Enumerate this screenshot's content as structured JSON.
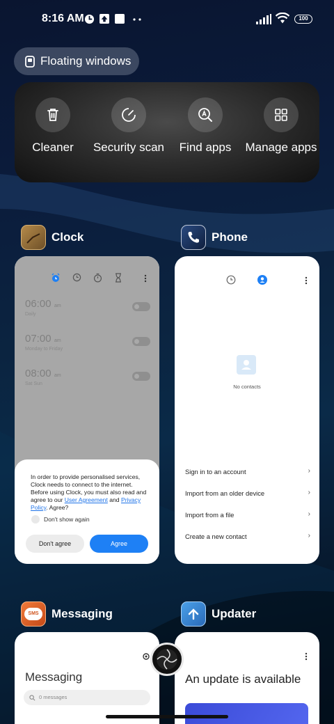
{
  "status_bar": {
    "time": "8:16 AM",
    "battery": "100"
  },
  "floating_windows": {
    "label": "Floating windows"
  },
  "tools": [
    {
      "label": "Cleaner",
      "icon": "trash-icon"
    },
    {
      "label": "Security scan",
      "icon": "security-scan-icon"
    },
    {
      "label": "Find apps",
      "icon": "find-apps-icon"
    },
    {
      "label": "Manage apps",
      "icon": "grid-icon"
    }
  ],
  "apps": {
    "clock": {
      "name": "Clock",
      "alarms": [
        {
          "time": "06:00",
          "ampm": "am",
          "repeat": "Daily"
        },
        {
          "time": "07:00",
          "ampm": "am",
          "repeat": "Monday to Friday"
        },
        {
          "time": "08:00",
          "ampm": "am",
          "repeat": "Sat Sun"
        }
      ],
      "dialog": {
        "text_before": "In order to provide personalised services, Clock needs to connect to the internet. Before using Clock, you must also read and agree to our ",
        "user_agreement": "User Agreement",
        "and": " and ",
        "privacy_policy": "Privacy Policy",
        "text_after": ". Agree?",
        "dont_show": "Don't show again",
        "disagree": "Don't agree",
        "agree": "Agree"
      }
    },
    "phone": {
      "name": "Phone",
      "no_contacts": "No contacts",
      "menu": [
        "Sign in to an account",
        "Import from an older device",
        "Import from a file",
        "Create a new contact"
      ]
    },
    "messaging": {
      "name": "Messaging",
      "title": "Messaging",
      "search_placeholder": "0 messages",
      "icon_text": "SMS"
    },
    "updater": {
      "name": "Updater",
      "title": "An update is available"
    }
  },
  "colors": {
    "accent": "#1e80f5",
    "clock_icon": "#8a6a3a",
    "phone_icon": "#1f3a6a",
    "messaging_icon": "#e0612a",
    "updater_icon": "#3a8ad8"
  }
}
